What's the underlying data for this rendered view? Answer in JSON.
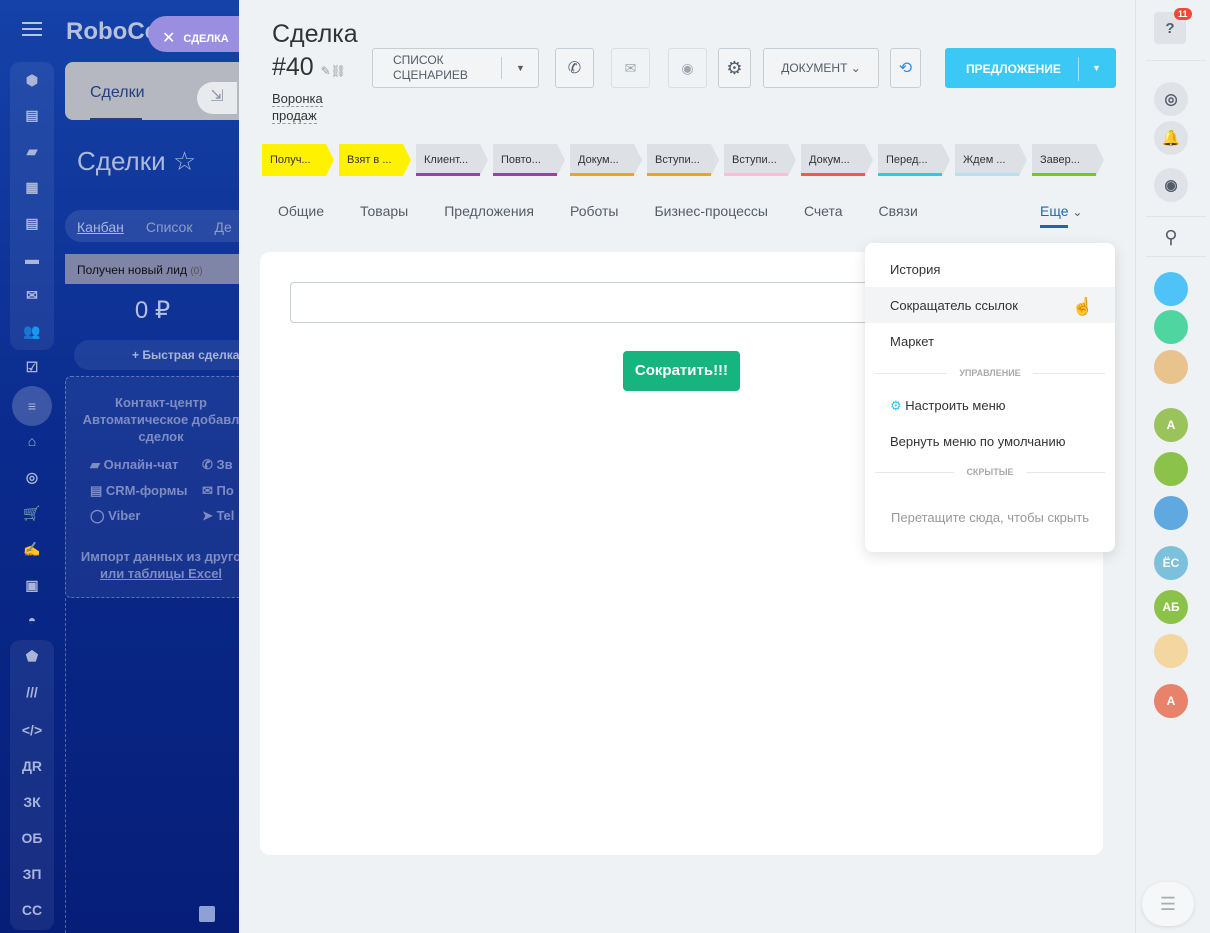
{
  "background": {
    "brand": "RoboCo",
    "tab_active": "Сделки",
    "title": "Сделки",
    "views": [
      "Канбан",
      "Список",
      "Де"
    ],
    "column": {
      "name": "Получен новый лид",
      "count": "(0)",
      "sum": "0 ₽"
    },
    "quick_deal": "+ Быстрая сделка",
    "contact_center": [
      "Контакт-центр",
      "Автоматическое добавл",
      "сделок"
    ],
    "sources": [
      "Онлайн-чат",
      "Зв",
      "CRM-формы",
      "По",
      "Viber",
      "Tel"
    ],
    "import": [
      "Импорт данных из друго",
      "или таблицы Excel"
    ],
    "nav_text": [
      "ДR",
      "ЗК",
      "ОБ",
      "ЗП",
      "СС"
    ]
  },
  "close_tab": {
    "icon": "close-icon",
    "label": "СДЕЛКА"
  },
  "deal": {
    "title": "Сделка",
    "number": "#40",
    "funnel": [
      "Воронка",
      "продаж"
    ]
  },
  "toolbar": {
    "scenarios": [
      "СПИСОК",
      "СЦЕНАРИЕВ"
    ],
    "document": "ДОКУМЕНТ",
    "offer": "ПРЕДЛОЖЕНИЕ"
  },
  "stages": [
    {
      "label": "Получ...",
      "color": "#fff200",
      "fill": true
    },
    {
      "label": "Взят в ...",
      "color": "#fff200",
      "fill": true
    },
    {
      "label": "Клиент...",
      "color": "#a23ea0"
    },
    {
      "label": "Повто...",
      "color": "#a23ea0"
    },
    {
      "label": "Докум...",
      "color": "#f4a021"
    },
    {
      "label": "Вступи...",
      "color": "#f4a021"
    },
    {
      "label": "Вступи...",
      "color": "#f7bfd8"
    },
    {
      "label": "Докум...",
      "color": "#ef5a4d"
    },
    {
      "label": "Перед...",
      "color": "#35c3ef"
    },
    {
      "label": "Ждем ...",
      "color": "#b7e1f3"
    },
    {
      "label": "Завер...",
      "color": "#7bc421"
    }
  ],
  "tabs": [
    "Общие",
    "Товары",
    "Предложения",
    "Роботы",
    "Бизнес-процессы",
    "Счета",
    "Связи"
  ],
  "more_tab": "Еще",
  "shortener": {
    "input_value": "",
    "button": "Сократить!!!"
  },
  "dropdown": {
    "items": [
      "История",
      "Сокращатель ссылок",
      "Маркет"
    ],
    "section_manage": "УПРАВЛЕНИЕ",
    "configure": "Настроить меню",
    "reset": "Вернуть меню по умолчанию",
    "section_hidden": "СКРЫТЫЕ",
    "hint": "Перетащите сюда, чтобы скрыть"
  },
  "right": {
    "help_badge": "11",
    "contacts": [
      {
        "initials": "",
        "color": "#4fc3f7"
      },
      {
        "initials": "",
        "color": "#4fd6a0"
      },
      {
        "initials": "",
        "color": "#e8c38d"
      },
      {
        "initials": "А",
        "color": "#9ac35c"
      },
      {
        "initials": "",
        "color": "#8bc34a"
      },
      {
        "initials": "",
        "color": "#5fa8e0"
      },
      {
        "initials": "ЁС",
        "color": "#7cc0dc"
      },
      {
        "initials": "АБ",
        "color": "#8bc34a"
      },
      {
        "initials": "",
        "color": "#f3d6a0"
      },
      {
        "initials": "А",
        "color": "#e8826b"
      }
    ]
  }
}
